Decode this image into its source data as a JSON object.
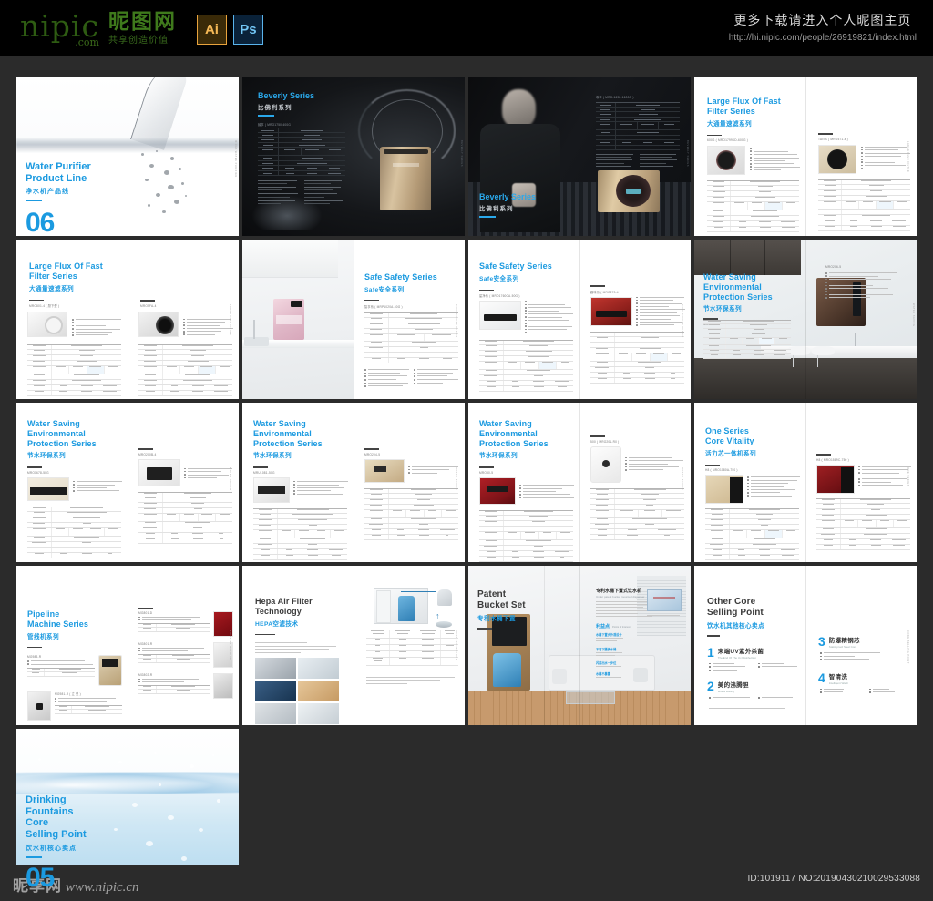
{
  "topbar": {
    "brand_name": "nipic",
    "brand_domain": ".com",
    "brand_cn": "昵图网",
    "brand_cn_sub": "共享创造价值",
    "app_icons": [
      {
        "name": "illustrator-icon",
        "label": "Ai"
      },
      {
        "name": "photoshop-icon",
        "label": "Ps"
      }
    ],
    "promo_cn": "更多下载请进入个人昵图主页",
    "promo_url": "http://hi.nipic.com/people/26919821/index.html"
  },
  "bottombar": {
    "watermark_cn": "昵享网",
    "watermark_url": "www.nipic.cn",
    "id_text": "ID:1019117 NO:20190430210029533088"
  },
  "accent_color": "#1b9ae0",
  "background_color": "#2b2b2b",
  "spreads": [
    {
      "id": "spread-01-water-purifier-cover",
      "title_en": "Water Purifier\nProduct Line",
      "title_en_line1": "Water Purifier",
      "title_en_line2": "Product Line",
      "title_cn": "净水机产品线",
      "number": "06",
      "style": "cover-water-pour"
    },
    {
      "id": "spread-02-beverly-series",
      "title_en_line1": "Beverly Series",
      "title_en_line2": "",
      "title_cn": "比佛利系列",
      "model_label": "臻享 ( MRO1750-400G )",
      "style": "dark-product"
    },
    {
      "id": "spread-03-beverly-series-man",
      "title_en_line1": "Beverly Series",
      "title_en_line2": "",
      "title_cn": "比佛利系列",
      "model_label": "尊享 ( MRO-1698-1600G )",
      "style": "dark-portrait"
    },
    {
      "id": "spread-04-large-flux-fast-filter",
      "title_en_line1": "Large Flux Of Fast",
      "title_en_line2": "Filter Series",
      "title_cn": "大通量速滤系列",
      "model_label_left": "600G ( MRO1799KD-600G )",
      "model_label_right": "TAISS ( MRO571-4 )",
      "style": "spec-two-page"
    },
    {
      "id": "spread-05-large-flux-fast-filter-b",
      "title_en_line1": "Large Flux Of Fast",
      "title_en_line2": "Filter Series",
      "title_cn": "大通量速滤系列",
      "model_label_left": "MRO801-4 ( 厨下型 )",
      "model_label_right": "MRO5FA-4",
      "style": "spec-two-page"
    },
    {
      "id": "spread-06-safe-safety-kitchen",
      "title_en_line1": "Safe Safety Series",
      "title_en_line2": "",
      "title_cn": "Safe安全系列",
      "model_label": "智享系 ( MRP1020A-50G )",
      "style": "kitchen-scene"
    },
    {
      "id": "spread-07-safe-safety-spec",
      "title_en_line1": "Safe Safety Series",
      "title_en_line2": "",
      "title_cn": "Safe安全系列",
      "model_label_left": "星净系 ( MRO1760CA-50G )",
      "model_label_right": "趣味系 ( MRO270-4 )",
      "style": "spec-two-page"
    },
    {
      "id": "spread-08-water-saving-kitchen",
      "title_en_line1": "Water Saving",
      "title_en_line2": "Environmental",
      "title_en_line3": "Protection Series",
      "title_cn": "节水环保系列",
      "model_label_left": "MRO206-5",
      "model_label_right": "MRO206-5",
      "style": "kitchen-scene-dark"
    },
    {
      "id": "spread-09-water-saving-a",
      "title_en_line1": "Water Saving",
      "title_en_line2": "Environmental",
      "title_en_line3": "Protection Series",
      "title_cn": "节水环保系列",
      "model_label_left": "MRO1678-50G",
      "model_label_right": "MRO200B-4",
      "style": "spec-two-page"
    },
    {
      "id": "spread-10-water-saving-b",
      "title_en_line1": "Water Saving",
      "title_en_line2": "Environmental",
      "title_en_line3": "Protection Series",
      "title_cn": "节水环保系列",
      "model_label_left": "MRU1081-50G",
      "model_label_right": "MRO204-5",
      "style": "spec-two-page"
    },
    {
      "id": "spread-11-water-saving-c",
      "title_en_line1": "Water Saving",
      "title_en_line2": "Environmental",
      "title_en_line3": "Protection Series",
      "title_cn": "节水环保系列",
      "model_label_left": "MRO30-5",
      "model_label_right": "500 ( MRO201-R0 )",
      "style": "spec-two-page"
    },
    {
      "id": "spread-12-one-series-core-vitality",
      "title_en_line1": "One Series",
      "title_en_line2": "Core Vitality",
      "title_cn": "活力芯一体机系列",
      "model_label_left": "H8 ( MRO1080A-750 )",
      "model_label_right": "H8 ( MRO1589C-750 )",
      "style": "spec-two-page"
    },
    {
      "id": "spread-13-pipeline-machine",
      "title_en_line1": "Pipeline",
      "title_en_line2": "Machine Series",
      "title_cn": "管线机系列",
      "model_labels": [
        "MG983-R",
        "MG981-R ( 立 型 )",
        "MG801-D",
        "MG801-R",
        "MG802-R"
      ],
      "style": "pipeline"
    },
    {
      "id": "spread-14-hepa-air-filter",
      "title_en_line1": "Hepa Air Filter",
      "title_en_line2": "Technology",
      "title_cn": "HEPA空滤技术",
      "style": "hepa"
    },
    {
      "id": "spread-15-patent-bucket-set",
      "title_en_line1": "Patent",
      "title_en_line2": "Bucket Set",
      "title_cn": "专利水桶下置",
      "section_cn": "专利水桶下置式饮水机",
      "section_en": "Under patent bucket mounted dispenser",
      "benefits_title_cn": "利益点",
      "benefits_title_en": "Points of Interest",
      "benefits": [
        "水桶下置式外观设计",
        "不弯下腰换水桶",
        "闪蒸出水一步位",
        "水桶不暴露"
      ],
      "style": "living-room"
    },
    {
      "id": "spread-16-other-core-selling-point",
      "title_en_line1": "Other Core",
      "title_en_line2": "Selling Point",
      "title_cn": "饮水机其他核心卖点",
      "points": [
        {
          "num": "1",
          "title_cn": "末端UV紫外杀菌",
          "title_en": "The End Of The Uv Disinfection"
        },
        {
          "num": "2",
          "title_cn": "美的沸腾胆",
          "title_en": "Midea Boiling"
        },
        {
          "num": "3",
          "title_cn": "防爆精钢芯",
          "title_en": "Static-proof Steel Core"
        },
        {
          "num": "4",
          "title_cn": "智清洗",
          "title_en": "Intelligent Wash"
        }
      ],
      "style": "selling-points"
    },
    {
      "id": "spread-17-drinking-fountains-cover",
      "title_en_line1": "Drinking",
      "title_en_line2": "Fountains",
      "title_en_line3": "Core",
      "title_en_line4": "Selling Point",
      "title_cn": "饮水机核心卖点",
      "number": "05",
      "style": "cover-splash"
    }
  ]
}
